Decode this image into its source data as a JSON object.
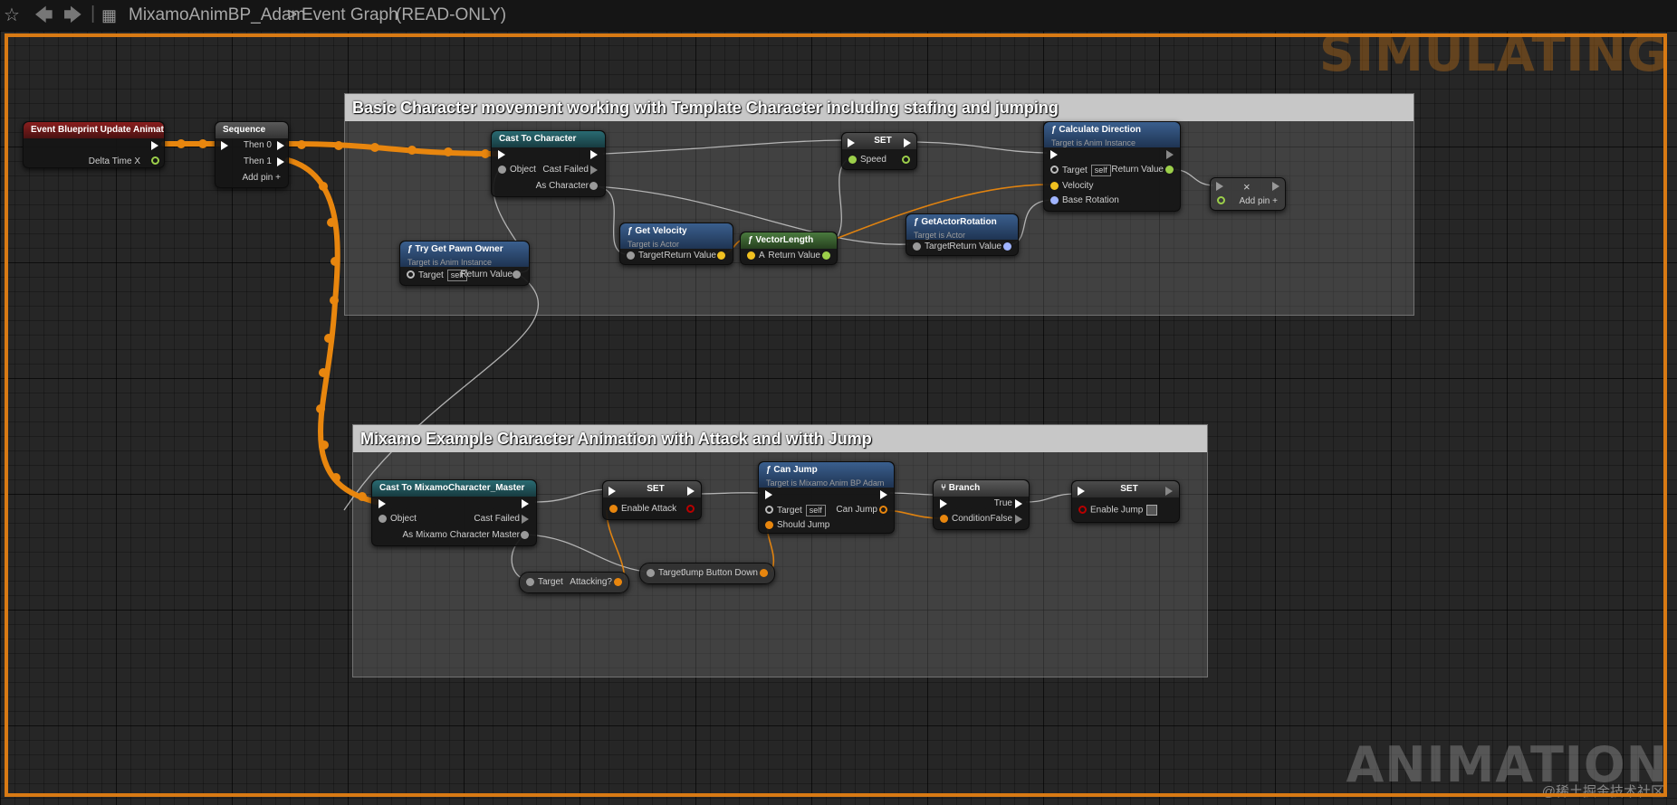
{
  "toolbar": {
    "favorite_icon": "star-icon",
    "back_icon": "arrow-left-icon",
    "forward_icon": "arrow-right-icon",
    "graph_icon": "blueprint-graph-icon",
    "asset": "MixamoAnimBP_Adam",
    "separator": ">",
    "graph": "Event Graph",
    "mode": "(READ-ONLY)"
  },
  "watermarks": {
    "top": "SIMULATING",
    "bottom": "ANIMATION",
    "credit": "@稀土掘金技术社区"
  },
  "colors": {
    "exec_highlight": "#e8860e",
    "simulating_border": "#d87a14"
  },
  "comments": {
    "basic": "Basic Character movement working with Template Character including stafing and jumping",
    "mixamo": "Mixamo Example Character Animation with Attack and witth Jump"
  },
  "nodes": {
    "event_update": {
      "title": "Event Blueprint Update Animation",
      "pin_delta": "Delta Time X"
    },
    "sequence": {
      "title": "Sequence",
      "then0": "Then 0",
      "then1": "Then 1",
      "add_pin": "Add pin"
    },
    "cast_character": {
      "title": "Cast To Character",
      "object": "Object",
      "cast_failed": "Cast Failed",
      "as_character": "As Character"
    },
    "try_get_pawn": {
      "title": "Try Get Pawn Owner",
      "subtitle": "Target is Anim Instance",
      "target": "Target",
      "self": "self",
      "return_value": "Return Value"
    },
    "get_velocity": {
      "title": "Get Velocity",
      "subtitle": "Target is Actor",
      "target": "Target",
      "return_value": "Return Value"
    },
    "vector_length": {
      "title": "VectorLength",
      "a": "A",
      "return_value": "Return Value"
    },
    "set_speed": {
      "title": "SET",
      "speed": "Speed"
    },
    "get_actor_rotation": {
      "title": "GetActorRotation",
      "subtitle": "Target is Actor",
      "target": "Target",
      "return_value": "Return Value"
    },
    "calc_direction": {
      "title": "Calculate Direction",
      "subtitle": "Target is Anim Instance",
      "target": "Target",
      "self": "self",
      "return_value": "Return Value",
      "velocity": "Velocity",
      "base_rotation": "Base Rotation"
    },
    "set_direction": {
      "add_pin": "Add pin",
      "close": "×"
    },
    "cast_mixamo": {
      "title": "Cast To MixamoCharacter_Master",
      "object": "Object",
      "cast_failed": "Cast Failed",
      "as_mixamo": "As Mixamo Character Master"
    },
    "set_attack": {
      "title": "SET",
      "enable_attack": "Enable Attack"
    },
    "get_attacking": {
      "target": "Target",
      "attacking": "Attacking?"
    },
    "can_jump": {
      "title": "Can Jump",
      "subtitle": "Target is Mixamo Anim BP Adam",
      "target": "Target",
      "self": "self",
      "should_jump": "Should Jump",
      "can_jump": "Can Jump"
    },
    "get_jump_button": {
      "target": "Target",
      "jump_button": "Jump Button Down"
    },
    "branch": {
      "title": "Branch",
      "true": "True",
      "false": "False",
      "condition": "Condition"
    },
    "set_jump": {
      "title": "SET",
      "enable_jump": "Enable Jump"
    }
  }
}
